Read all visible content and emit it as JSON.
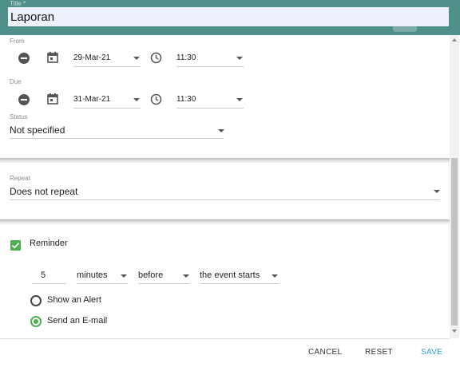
{
  "title": {
    "label": "Title *",
    "value": "Laporan"
  },
  "from": {
    "label": "From",
    "date": "29-Mar-21",
    "time": "11:30"
  },
  "due": {
    "label": "Due",
    "date": "31-Mar-21",
    "time": "11:30"
  },
  "status": {
    "label": "Status",
    "value": "Not specified"
  },
  "repeat": {
    "label": "Repeat",
    "value": "Does not repeat"
  },
  "reminder": {
    "label": "Reminder",
    "checked": true,
    "amount": "5",
    "unit": "minutes",
    "relation": "before",
    "anchor": "the event starts",
    "options": [
      {
        "label": "Show an Alert",
        "selected": false
      },
      {
        "label": "Send an E-mail",
        "selected": true
      }
    ]
  },
  "footer": {
    "cancel": "CANCEL",
    "reset": "RESET",
    "save": "SAVE"
  },
  "colors": {
    "header": "#4f8f8a",
    "accent": "#4caf50",
    "save": "#29a3d6"
  }
}
